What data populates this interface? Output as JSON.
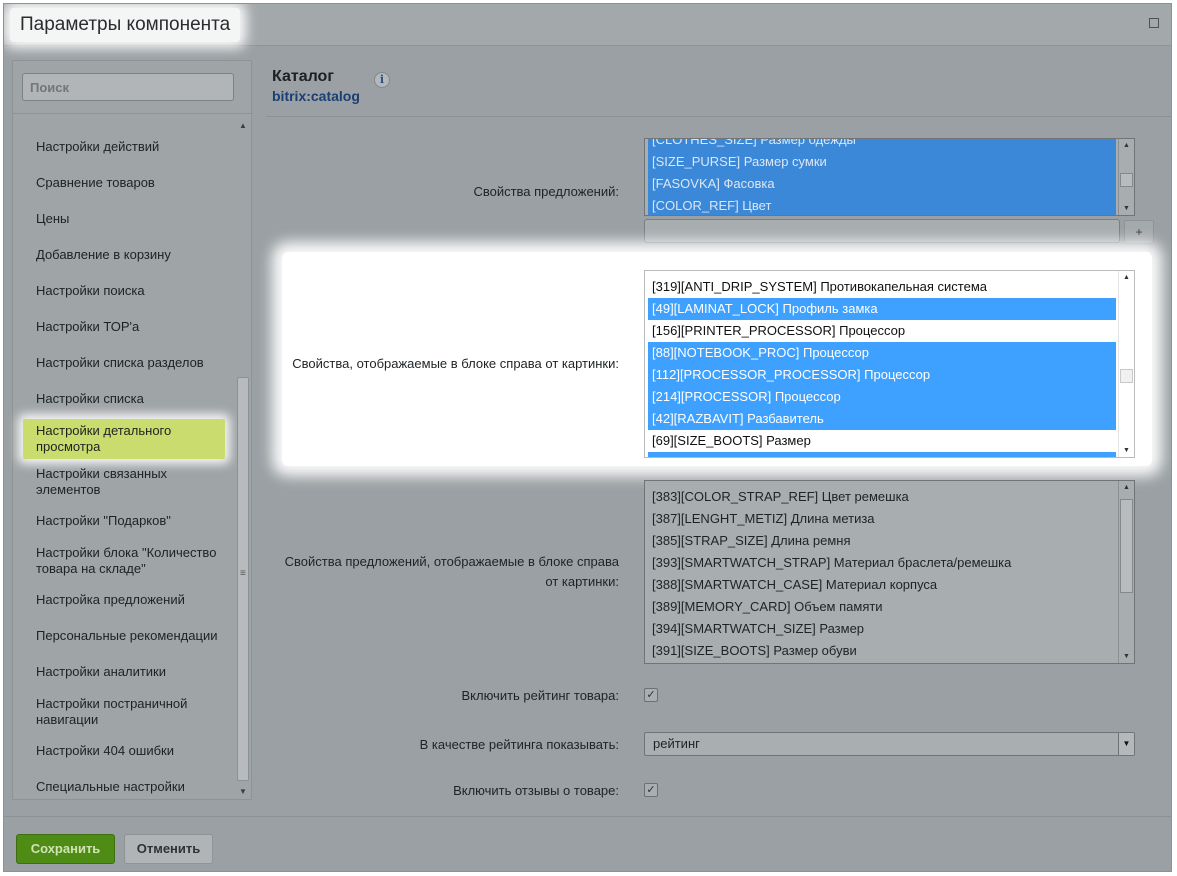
{
  "window": {
    "title": "Параметры компонента"
  },
  "sidebar": {
    "search_placeholder": "Поиск",
    "items": [
      "Настройки действий",
      "Сравнение товаров",
      "Цены",
      "Добавление в корзину",
      "Настройки поиска",
      "Настройки ТОР'а",
      "Настройки списка разделов",
      "Настройки списка",
      "Настройки детального просмотра",
      "Настройки связанных элементов",
      "Настройки \"Подарков\"",
      "Настройки блока \"Количество товара на складе\"",
      "Настройка предложений",
      "Персональные рекомендации",
      "Настройки аналитики",
      "Настройки постраничной навигации",
      "Настройки 404 ошибки",
      "Специальные настройки"
    ],
    "active_index": 8
  },
  "header": {
    "title": "Каталог",
    "subtitle": "bitrix:catalog",
    "info_glyph": "i"
  },
  "fields": {
    "offer_props": {
      "label": "Свойства предложений:",
      "options": [
        {
          "text": "[CLOTHES_SIZE] Размер одежды",
          "selected": true
        },
        {
          "text": "[SIZE_PURSE] Размер сумки",
          "selected": true
        },
        {
          "text": "[FASOVKA] Фасовка",
          "selected": true
        },
        {
          "text": "[COLOR_REF] Цвет",
          "selected": true
        }
      ],
      "add_label": "+",
      "input_value": ""
    },
    "right_props": {
      "label": "Свойства, отображаемые в блоке справа от картинки:",
      "options": [
        {
          "text": "[319][ANTI_DRIP_SYSTEM] Противокапельная система",
          "selected": false
        },
        {
          "text": "[49][LAMINAT_LOCK] Профиль замка",
          "selected": true
        },
        {
          "text": "[156][PRINTER_PROCESSOR] Процессор",
          "selected": false
        },
        {
          "text": "[88][NOTEBOOK_PROC] Процессор",
          "selected": true
        },
        {
          "text": "[112][PROCESSOR_PROCESSOR] Процессор",
          "selected": true
        },
        {
          "text": "[214][PROCESSOR] Процессор",
          "selected": true
        },
        {
          "text": "[42][RAZBAVIT] Разбавитель",
          "selected": true
        },
        {
          "text": "[69][SIZE_BOOTS] Размер",
          "selected": false
        }
      ]
    },
    "offer_right_props": {
      "label": "Свойства предложений, отображаемые в блоке справа от картинки:",
      "options": [
        {
          "text": "[383][COLOR_STRAP_REF] Цвет ремешка",
          "selected": false
        },
        {
          "text": "[387][LENGHT_METIZ] Длина метиза",
          "selected": false
        },
        {
          "text": "[385][STRAP_SIZE] Длина ремня",
          "selected": false
        },
        {
          "text": "[393][SMARTWATCH_STRAP] Материал браслета/ремешка",
          "selected": false
        },
        {
          "text": "[388][SMARTWATCH_CASE] Материал корпуса",
          "selected": false
        },
        {
          "text": "[389][MEMORY_CARD] Объем памяти",
          "selected": false
        },
        {
          "text": "[394][SMARTWATCH_SIZE] Размер",
          "selected": false
        },
        {
          "text": "[391][SIZE_BOOTS] Размер обуви",
          "selected": false
        }
      ]
    },
    "rating_enable": {
      "label": "Включить рейтинг товара:",
      "checked": true
    },
    "rating_display": {
      "label": "В качестве рейтинга показывать:",
      "value": "рейтинг"
    },
    "reviews_enable": {
      "label": "Включить отзывы о товаре:",
      "checked": true
    }
  },
  "footer": {
    "save_label": "Сохранить",
    "cancel_label": "Отменить"
  },
  "colors": {
    "accent_save": "#4f8c16",
    "selection": "#3ea1ff",
    "active_nav": "#c9dc6d",
    "link_blue": "#1b3f74"
  }
}
